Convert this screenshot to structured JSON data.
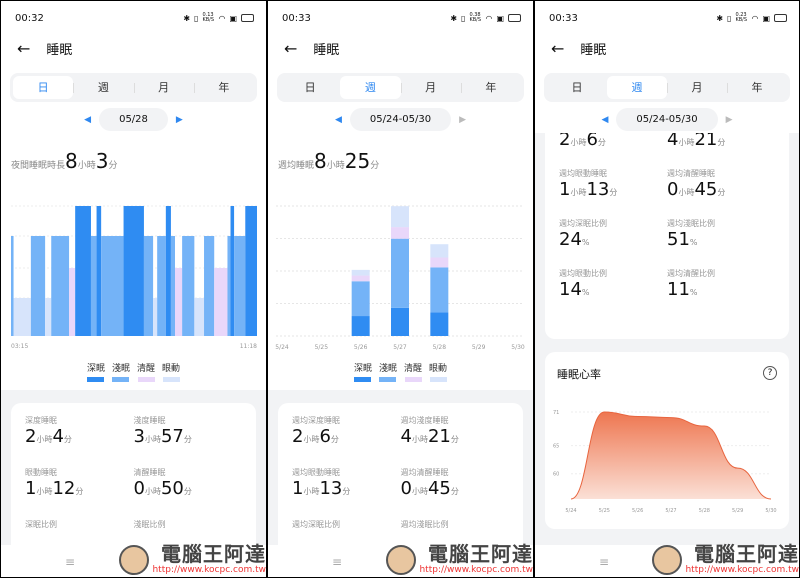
{
  "common": {
    "title": "睡眠",
    "back_icon": "←",
    "tabs": [
      "日",
      "週",
      "月",
      "年"
    ],
    "hours_unit": "小時",
    "min_unit": "分",
    "pct_unit": "%",
    "legend": [
      "深眠",
      "淺眠",
      "清醒",
      "眼動"
    ],
    "menu_icon": "≡",
    "watermark": {
      "text": "電腦王阿達",
      "url": "http://www.kocpc.com.tw"
    }
  },
  "colors": {
    "deep": "#2f8cf2",
    "light": "#74b3f7",
    "awake": "#e9d7fa",
    "rem": "#d7e4fb",
    "accent": "#2f88f0",
    "heart": "#e8643e"
  },
  "panels": [
    {
      "time": "00:32",
      "net": "0.13 KB/S",
      "active_tab": 0,
      "date": "05/28",
      "headline_label": "夜間睡眠時長",
      "headline_h": "8",
      "headline_m": "3",
      "x_start": "03:15",
      "x_end": "11:18",
      "stats": [
        {
          "label": "深度睡眠",
          "h": "2",
          "m": "4"
        },
        {
          "label": "淺度睡眠",
          "h": "3",
          "m": "57"
        },
        {
          "label": "眼動睡眠",
          "h": "1",
          "m": "12"
        },
        {
          "label": "清醒睡眠",
          "h": "0",
          "m": "50"
        },
        {
          "label": "深眠比例"
        },
        {
          "label": "淺眠比例"
        }
      ]
    },
    {
      "time": "00:33",
      "net": "0.38 KB/S",
      "active_tab": 1,
      "date": "05/24-05/30",
      "headline_label": "週均睡眠",
      "headline_h": "8",
      "headline_m": "25",
      "stats": [
        {
          "label": "週均深度睡眠",
          "h": "2",
          "m": "6"
        },
        {
          "label": "週均淺度睡眠",
          "h": "4",
          "m": "21"
        },
        {
          "label": "週均眼動睡眠",
          "h": "1",
          "m": "13"
        },
        {
          "label": "週均清醒睡眠",
          "h": "0",
          "m": "45"
        },
        {
          "label": "週均深眠比例"
        },
        {
          "label": "週均淺眠比例"
        }
      ]
    },
    {
      "time": "00:33",
      "net": "0.23 KB/S",
      "active_tab": 1,
      "date": "05/24-05/30",
      "stats": [
        {
          "h": "2",
          "m": "6"
        },
        {
          "h": "4",
          "m": "21"
        },
        {
          "label": "週均眼動睡眠",
          "h": "1",
          "m": "13"
        },
        {
          "label": "週均清醒睡眠",
          "h": "0",
          "m": "45"
        },
        {
          "label": "週均深眠比例",
          "pct": "24"
        },
        {
          "label": "週均淺眠比例",
          "pct": "51"
        },
        {
          "label": "週均眼動比例",
          "pct": "14"
        },
        {
          "label": "週均清醒比例",
          "pct": "11"
        }
      ],
      "heart_title": "睡眠心率",
      "help_icon": "?"
    }
  ],
  "chart_data": [
    {
      "type": "bar",
      "title": "daily sleep stages (minutes from 03:15)",
      "total_min": 483,
      "segments": [
        [
          "light",
          0,
          5
        ],
        [
          "rem",
          5,
          39
        ],
        [
          "light",
          39,
          67
        ],
        [
          "rem",
          67,
          79
        ],
        [
          "light",
          79,
          114
        ],
        [
          "awake",
          114,
          126
        ],
        [
          "deep",
          126,
          157
        ],
        [
          "light",
          157,
          168
        ],
        [
          "deep",
          168,
          177
        ],
        [
          "light",
          177,
          221
        ],
        [
          "deep",
          221,
          261
        ],
        [
          "light",
          261,
          279
        ],
        [
          "rem",
          279,
          287
        ],
        [
          "light",
          287,
          304
        ],
        [
          "deep",
          304,
          314
        ],
        [
          "light",
          314,
          322
        ],
        [
          "awake",
          322,
          336
        ],
        [
          "light",
          336,
          360
        ],
        [
          "rem",
          360,
          379
        ],
        [
          "light",
          379,
          399
        ],
        [
          "awake",
          399,
          425
        ],
        [
          "light",
          425,
          431
        ],
        [
          "deep",
          431,
          438
        ],
        [
          "light",
          438,
          460
        ],
        [
          "deep",
          460,
          483
        ]
      ]
    },
    {
      "type": "bar",
      "title": "weekly sleep stages (minutes)",
      "categories": [
        "5/24",
        "5/25",
        "5/26",
        "5/27",
        "5/28",
        "5/29",
        "5/30"
      ],
      "ylim": [
        0,
        684
      ],
      "series": [
        {
          "name": "深眠",
          "values": [
            0,
            0,
            105,
            148,
            124,
            0,
            0
          ]
        },
        {
          "name": "淺眠",
          "values": [
            0,
            0,
            183,
            364,
            237,
            0,
            0
          ]
        },
        {
          "name": "清醒",
          "values": [
            0,
            0,
            30,
            61,
            52,
            0,
            0
          ]
        },
        {
          "name": "眼動",
          "values": [
            0,
            0,
            30,
            110,
            70,
            0,
            0
          ]
        }
      ]
    },
    {
      "type": "area",
      "title": "睡眠心率",
      "categories": [
        "5/24",
        "5/25",
        "5/26",
        "5/27",
        "5/28",
        "5/29",
        "5/30"
      ],
      "values": [
        55.5,
        71,
        70.2,
        70,
        68.5,
        61,
        55.5
      ],
      "yticks": [
        "71",
        "65",
        "60"
      ],
      "ylim": [
        55.5,
        71
      ]
    }
  ]
}
